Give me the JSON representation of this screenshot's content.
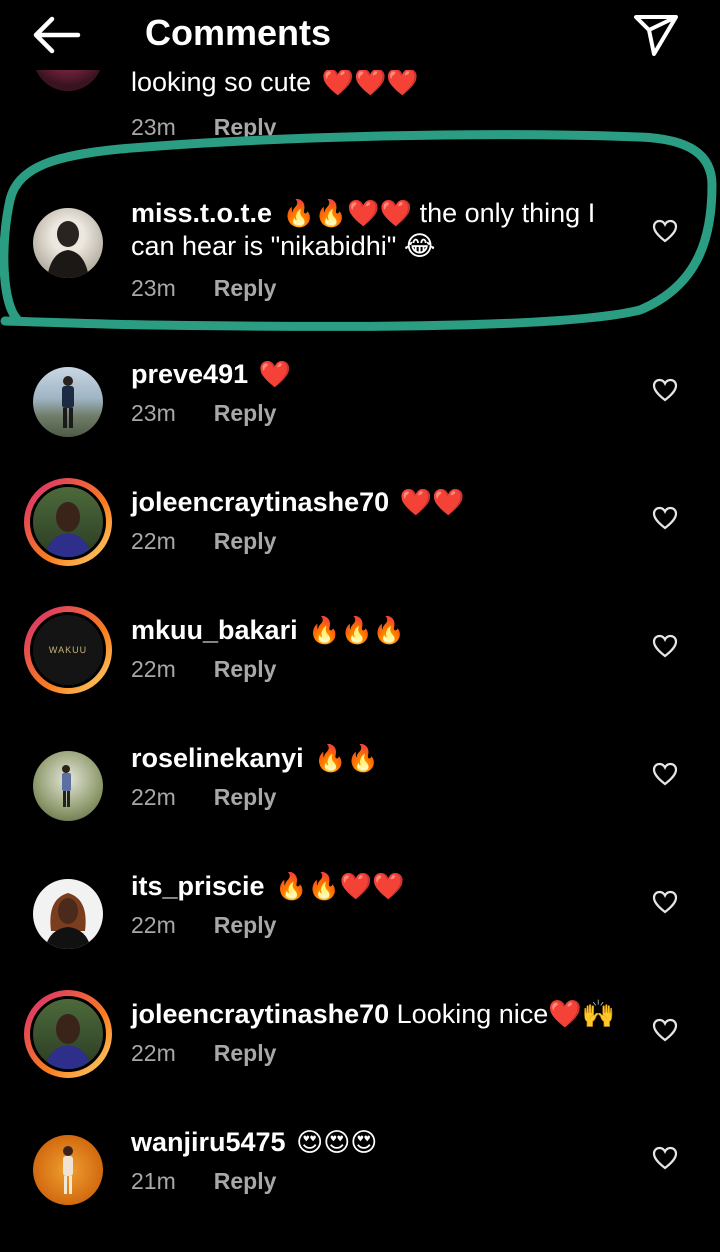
{
  "header": {
    "title": "Comments"
  },
  "partial": {
    "text": "looking so cute",
    "emoji": "❤️❤️❤️",
    "time": "23m",
    "reply": "Reply"
  },
  "comments": [
    {
      "user": "miss.t.o.t.e",
      "emoji": "🔥🔥❤️❤️",
      "text": "the only thing I can hear is \"nikabidhi\" 😂",
      "time": "23m",
      "reply": "Reply"
    },
    {
      "user": "preve491",
      "emoji": "❤️",
      "text": "",
      "time": "23m",
      "reply": "Reply"
    },
    {
      "user": "joleencraytinashe70",
      "emoji": "❤️❤️",
      "text": "",
      "time": "22m",
      "reply": "Reply"
    },
    {
      "user": "mkuu_bakari",
      "emoji": "🔥🔥🔥",
      "text": "",
      "time": "22m",
      "reply": "Reply"
    },
    {
      "user": "roselinekanyi",
      "emoji": "🔥🔥",
      "text": "",
      "time": "22m",
      "reply": "Reply"
    },
    {
      "user": "its_priscie",
      "emoji": "🔥🔥❤️❤️",
      "text": "",
      "time": "22m",
      "reply": "Reply"
    },
    {
      "user": "joleencraytinashe70",
      "emoji": "",
      "text": "Looking nice❤️🙌",
      "time": "22m",
      "reply": "Reply"
    },
    {
      "user": "wanjiru5475",
      "emoji": "😍😍😍",
      "text": "",
      "time": "21m",
      "reply": "Reply"
    }
  ],
  "avatar_logo_text": "WAKUU",
  "colors": {
    "background": "#000000",
    "meta": "#a8a8a8",
    "highlight": "#2a9d82"
  }
}
